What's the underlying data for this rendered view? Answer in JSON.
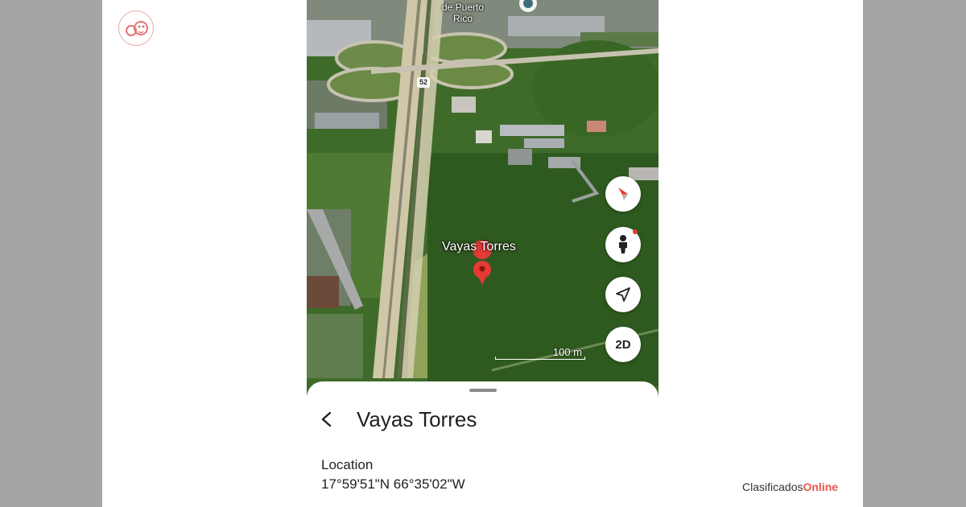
{
  "map": {
    "place_label_line1": "de Puerto",
    "place_label_line2": "Rico",
    "highway_shield": "52",
    "pin_label": "Vayas Torres",
    "scale": "100 m"
  },
  "controls": {
    "compass_icon": "compass-icon",
    "street_view_icon": "pegman-icon",
    "location_icon": "navigation-arrow-icon",
    "view_mode": "2D"
  },
  "sheet": {
    "title": "Vayas Torres",
    "location_label": "Location",
    "coordinates": "17°59'51\"N 66°35'02\"W"
  },
  "watermark": {
    "prefix": "Clasificados",
    "accent": "Online"
  },
  "colors": {
    "pin": "#e53935",
    "watermark_accent": "#e8554e",
    "background": "#a4a5a7"
  }
}
